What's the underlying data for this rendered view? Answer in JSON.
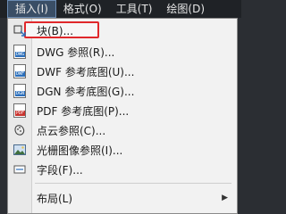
{
  "menubar": {
    "items": [
      {
        "label": "插入(I)"
      },
      {
        "label": "格式(O)"
      },
      {
        "label": "工具(T)"
      },
      {
        "label": "绘图(D)"
      }
    ]
  },
  "menu": {
    "items": [
      {
        "label": "块(B)...",
        "icon": "block-insert-icon"
      },
      {
        "label": "DWG 参照(R)...",
        "icon": "dwg-file-icon",
        "tag": "DWG"
      },
      {
        "label": "DWF 参考底图(U)...",
        "icon": "dwf-file-icon",
        "tag": "DWF"
      },
      {
        "label": "DGN 参考底图(G)...",
        "icon": "dgn-file-icon",
        "tag": "DGN"
      },
      {
        "label": "PDF 参考底图(P)...",
        "icon": "pdf-file-icon",
        "tag": "PDF"
      },
      {
        "label": "点云参照(C)...",
        "icon": "point-cloud-icon"
      },
      {
        "label": "光栅图像参照(I)...",
        "icon": "raster-image-icon"
      },
      {
        "label": "字段(F)...",
        "icon": "field-icon"
      },
      {
        "label": "布局(L)",
        "submenu_arrow": "▶"
      }
    ]
  },
  "colors": {
    "highlight_border": "#e0282b",
    "menubar_bg": "#1f2226",
    "menu_bg": "#f2f2f2"
  }
}
